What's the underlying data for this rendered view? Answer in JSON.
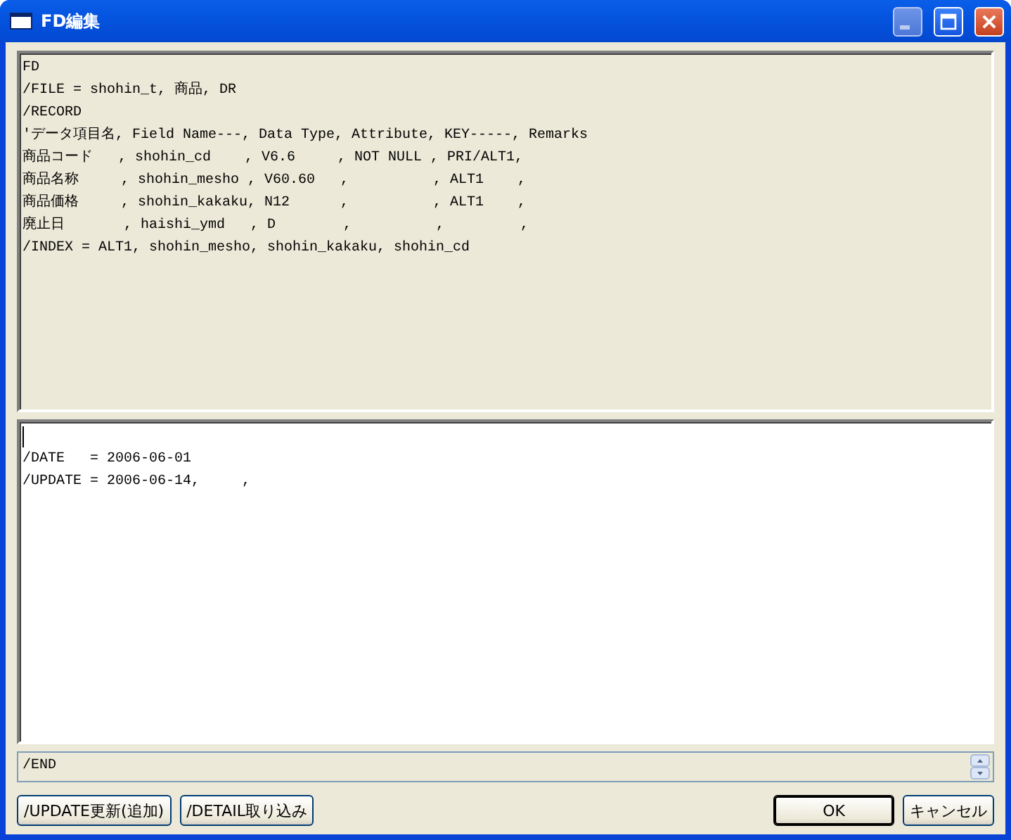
{
  "window": {
    "title": "FD編集"
  },
  "definition_lines": [
    "FD",
    "/FILE = shohin_t, 商品, DR",
    "/RECORD",
    "'データ項目名, Field Name---, Data Type, Attribute, KEY-----, Remarks",
    "商品コード   , shohin_cd    , V6.6     , NOT NULL , PRI/ALT1,",
    "商品名称     , shohin_mesho , V60.60   ,          , ALT1    ,",
    "商品価格     , shohin_kakaku, N12      ,          , ALT1    ,",
    "廃止日       , haishi_ymd   , D        ,          ,         ,",
    "/INDEX = ALT1, shohin_mesho, shohin_kakaku, shohin_cd"
  ],
  "detail_lines": [
    "/DATE   = 2006-06-01",
    "/UPDATE = 2006-06-14,     ,"
  ],
  "end_field": {
    "value": "/END"
  },
  "buttons": [
    {
      "label": "/UPDATE更新(追加)",
      "kind": "left"
    },
    {
      "label": "/DETAIL取り込み",
      "kind": "left"
    },
    {
      "label": "OK",
      "kind": "default"
    },
    {
      "label": "キャンセル",
      "kind": "right"
    }
  ]
}
